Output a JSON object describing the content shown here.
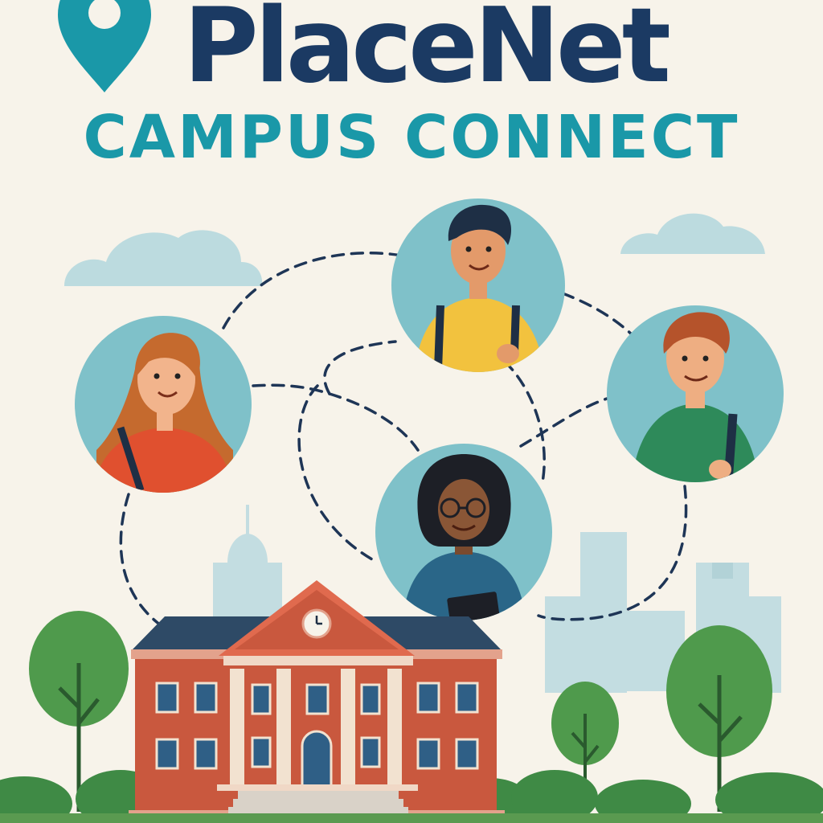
{
  "brand": {
    "name": "PlaceNet",
    "tagline": "CAMPUS CONNECT",
    "logo_icon": "map-pin-icon"
  },
  "colors": {
    "background": "#f7f3ea",
    "brand_navy": "#1b3a63",
    "brand_teal": "#1a98a8",
    "avatar_bg": "#7fc1c9",
    "connection_line": "#1e3556",
    "building_brick": "#c9583e",
    "roof": "#2e4a66",
    "tree_green": "#4f9a4c",
    "skyline": "#b9d8dc"
  },
  "illustration": {
    "avatars": [
      {
        "name": "student-red-shirt",
        "shirt": "#e0502f"
      },
      {
        "name": "student-yellow-shirt",
        "shirt": "#f2c23e"
      },
      {
        "name": "student-green-shirt",
        "shirt": "#2e8a5a"
      },
      {
        "name": "student-blue-shirt",
        "shirt": "#2a6688"
      }
    ]
  }
}
